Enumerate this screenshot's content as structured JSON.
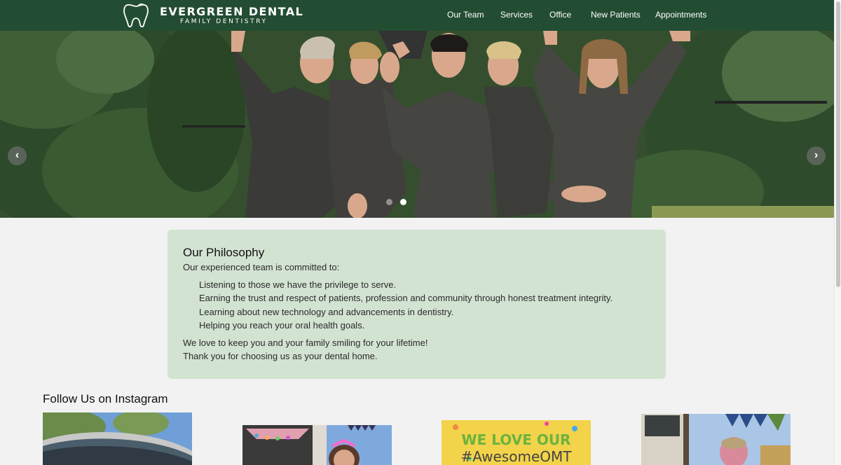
{
  "brand": {
    "name": "EVERGREEN DENTAL",
    "tagline": "FAMILY DENTISTRY"
  },
  "nav": [
    {
      "label": "Our Team"
    },
    {
      "label": "Services"
    },
    {
      "label": "Office"
    },
    {
      "label": "New Patients"
    },
    {
      "label": "Appointments"
    }
  ],
  "carousel": {
    "prev_icon": "chevron-left-icon",
    "next_icon": "chevron-right-icon",
    "slide_count": 2,
    "active_slide": 2
  },
  "philosophy": {
    "title": "Our Philosophy",
    "intro": "Our experienced team is committed to:",
    "points": [
      "Listening to those we have the privilege to serve.",
      "Earning the trust and respect of patients, profession and community through honest treatment integrity.",
      "Learning about new technology and advancements in dentistry.",
      "Helping you reach your oral health goals."
    ],
    "closing": [
      "We love to keep you and your family smiling for your lifetime!",
      "Thank you for choosing us as your dental home."
    ]
  },
  "instagram": {
    "title": "Follow Us on Instagram",
    "posts": [
      {
        "caption": ""
      },
      {
        "caption": ""
      },
      {
        "caption_line1": "WE LOVE OUR",
        "caption_line2": "#AwesomeOMT"
      },
      {
        "caption": ""
      }
    ]
  },
  "colors": {
    "header_bg": "#234d33",
    "philosophy_bg": "#d3e3d2",
    "page_bg": "#f2f2f2"
  }
}
